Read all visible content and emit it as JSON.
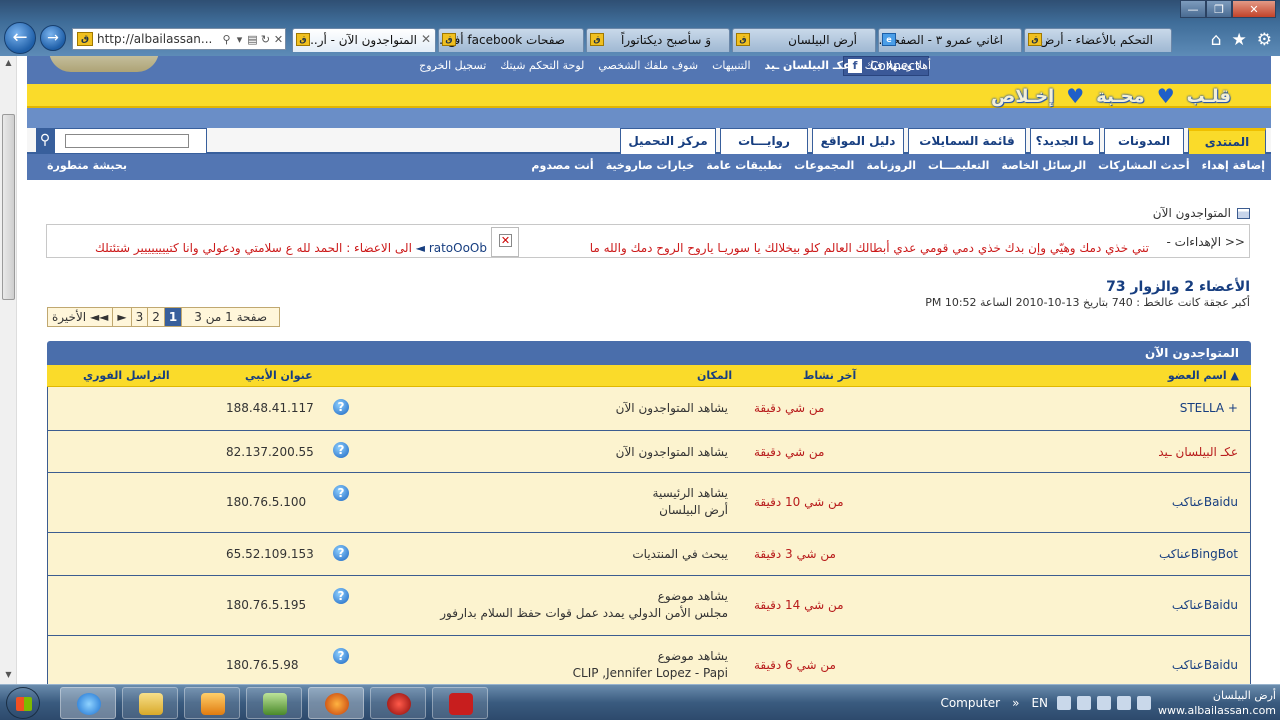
{
  "browser": {
    "url": "http://albailassan...",
    "tabs": [
      {
        "label": "المتواجدون الآن - أر..."
      },
      {
        "label": "صفحات facebook أفج..."
      },
      {
        "label": "وَ سأصبح ديكتاتوراً"
      },
      {
        "label": "أرض البيلسان"
      },
      {
        "label": "اغاني عمرو ٣ - الصفحه..."
      },
      {
        "label": "التحكم بالأعضاء - أرض..."
      }
    ],
    "controls": {
      "minimize": "—",
      "maximize": "❐",
      "close": "✕"
    },
    "icons": {
      "home": "⌂",
      "favorites": "★",
      "tools": "⚙"
    }
  },
  "site": {
    "userbar": {
      "welcome": "أهلا وسهلا فيك",
      "username": "عكـ البيلسان ـيد",
      "notifications": "التنبيهات",
      "profile": "شوف ملفك الشخصي",
      "control_panel": "لوحة التحكم شيتك",
      "logout": "تسجيل الخروج"
    },
    "connect_label": "Connect",
    "connect_icon": "f",
    "slogan": [
      "قلـب",
      "محـبة",
      "إخـلاص"
    ],
    "nav_tabs": [
      {
        "label": "المنتدى",
        "active": true
      },
      {
        "label": "المدونات",
        "active": false
      },
      {
        "label": "ما الجديد؟",
        "active": false
      },
      {
        "label": "قائمة السمايلات",
        "active": false
      },
      {
        "label": "دليل المواقع",
        "active": false
      },
      {
        "label": "روايـــات",
        "active": false
      },
      {
        "label": "مركز التحميل",
        "active": false
      }
    ],
    "search_icon": "⚲",
    "sub_nav": [
      "إضافة إهداء",
      "أحدث المشاركات",
      "الرسائل الخاصة",
      "التعليمـــات",
      "الروزنامة",
      "المجموعات",
      "تطبيقات عامة",
      "خيارات صاروخية",
      "أنت مصدوم"
    ],
    "sub_nav_left": "بحبشة متطورة"
  },
  "breadcrumb": "المتواجدون الآن",
  "dedications": {
    "label": "- الإهداءات >>",
    "text": "تني خذي دمك وهيّي وإن بدك خذي دمي قومي عدي أبطالك العالم كلو بيخلالك يا سوريـا ياروح الروح دمك والله ما",
    "author": "ratoOoOb",
    "text2": "الى الاعضاء : الحمد لله ع سلامتي ودعولي وانا كتيييييييير شتئتلك",
    "broken_image": "✕"
  },
  "stats": {
    "title": "الأعضاء 2 والزوار 73",
    "record": "أكبر عجقة كانت عالخط : 740 بتاريخ 13-10-2010 الساعة 10:52 PM"
  },
  "pagination": {
    "info": "صفحة 1 من 3",
    "pages": [
      "1",
      "2",
      "3"
    ],
    "current": "1",
    "next": "►",
    "last": "الأخيرة ◄◄"
  },
  "table": {
    "title": "المتواجدون الآن",
    "columns": {
      "member": "اسم العضو ▲",
      "last_activity": "آخر نشاط",
      "location": "المكان",
      "ip": "عنوان الأيبي",
      "im": "التراسل الفوري"
    },
    "help_icon": "?",
    "rows": [
      {
        "member": "STELLA +",
        "last_activity": "من شي دقيقة",
        "location": "يشاهد المتواجدون الآن",
        "location2": "",
        "ip": "188.48.41.117"
      },
      {
        "member": "عكـ البيلسان ـيد",
        "last_activity": "من شي دقيقة",
        "location": "يشاهد المتواجدون الآن",
        "location2": "",
        "ip": "82.137.200.55"
      },
      {
        "member": "عناكبBaidu",
        "last_activity": "من شي 10 دقيقة",
        "location": "يشاهد الرئيسية",
        "location2": "أرض البيلسان",
        "ip": "180.76.5.100"
      },
      {
        "member": "عناكبBingBot",
        "last_activity": "من شي 3 دقيقة",
        "location": "يبحث في المنتديات",
        "location2": "",
        "ip": "65.52.109.153"
      },
      {
        "member": "عناكبBaidu",
        "last_activity": "من شي 14 دقيقة",
        "location": "يشاهد موضوع",
        "location2": "مجلس الأمن الدولي يمدد عمل قوات حفظ السلام بدارفور",
        "ip": "180.76.5.195"
      },
      {
        "member": "عناكبBaidu",
        "last_activity": "من شي 6 دقيقة",
        "location": "يشاهد موضوع",
        "location2": "CLIP ,Jennifer Lopez - Papi",
        "ip": "180.76.5.98"
      }
    ]
  },
  "taskbar": {
    "computer_label": "Computer",
    "lang": "EN",
    "clock_line1": "أرض البيلسان",
    "clock_line2": "www.albailassan.com"
  }
}
